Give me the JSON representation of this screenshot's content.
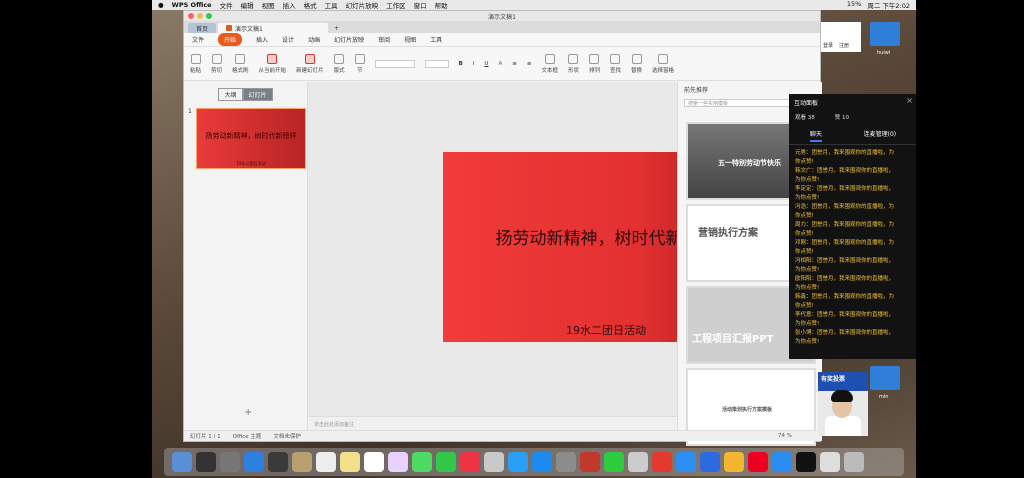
{
  "menubar": {
    "apple": "",
    "app_name": "WPS Office",
    "items": [
      "文件",
      "编辑",
      "视图",
      "插入",
      "格式",
      "工具",
      "幻灯片放映",
      "工作区",
      "窗口",
      "帮助"
    ],
    "status_text": "15%",
    "clock": "周二 下午2:02"
  },
  "window": {
    "title": "演示文稿1",
    "tabs": {
      "home": "首页",
      "doc": "演示文稿1",
      "plus": "+"
    }
  },
  "ribbon": {
    "file": "文件",
    "tabs": [
      "开始",
      "插入",
      "设计",
      "动画",
      "幻灯片放映",
      "审阅",
      "视图",
      "工具"
    ],
    "active": "开始"
  },
  "toolbar": {
    "tools": [
      "粘贴",
      "剪切",
      "格式刷",
      "从当前开始",
      "新建幻灯片",
      "版式",
      "节",
      "文本框",
      "形状",
      "排列",
      "查找",
      "替换",
      "选择窗格"
    ]
  },
  "left_panel": {
    "tab_outline": "大纲",
    "tab_slides": "幻灯片",
    "thumb_num": "1",
    "thumb_title": "扬劳动新精神，树时代新榜样",
    "thumb_sub": "19水二团日活动",
    "add": "+"
  },
  "slide": {
    "title": "扬劳动新精神，树时代新榜样",
    "subtitle": "19水二团日活动"
  },
  "notes_placeholder": "单击此处添加备注",
  "right_panel": {
    "header": "前先推荐",
    "search_placeholder": "搜索一些实用模板",
    "templates": [
      {
        "label": "五一特别劳动节快乐"
      },
      {
        "label": "营销执行方案"
      },
      {
        "label": "工程项目汇报PPT"
      },
      {
        "label": "活动策划执行方案模板"
      }
    ]
  },
  "statusbar": {
    "slide_index": "幻灯片 1 / 1",
    "theme": "Office 主题",
    "backup": "文档未保护",
    "zoom": "74 %"
  },
  "chat": {
    "title": "互动面板",
    "stat_people": "观看 38",
    "stat_likes": "赞 10",
    "tab_chat": "聊天",
    "tab_mic": "连麦管理(0)",
    "messages": [
      "元男：团誉月，我来围观你的直播啦，为",
      "你点赞!",
      "韩文广：团誉月，我来围观你的直播啦，",
      "为你点赞!",
      "李定定：团誉月，我来围观你的直播啦，",
      "为你点赞!",
      "冯浩：团誉月，我来围观你的直播啦，为",
      "你点赞!",
      "周力：团誉月，我来围观你的直播啦，为",
      "你点赞!",
      "邓刚：团誉月，我来围观你的直播啦，为",
      "你点赞!",
      "冯相阳：团誉月，我来围观你的直播啦，",
      "为你点赞!",
      "欧阳阳：团誉月，我来围观你的直播啦，",
      "为你点赞!",
      "韩鑫：团誉月，我来围观你的直播啦，为",
      "你点赞!",
      "李代意：团誉月，我来围观你的直播啦，",
      "为你点赞!",
      "张小博：团誉月，我来围观你的直播啦，",
      "为你点赞!"
    ]
  },
  "side_web": {
    "login": "登录",
    "register": "注册"
  },
  "avatar_caption": "有奖投票",
  "desktop": {
    "label1": "huiwi",
    "label2": "min"
  },
  "colors": {
    "accent": "#e85a1c",
    "slide_red": "#f23b3b",
    "chat_text": "#f2c230"
  }
}
